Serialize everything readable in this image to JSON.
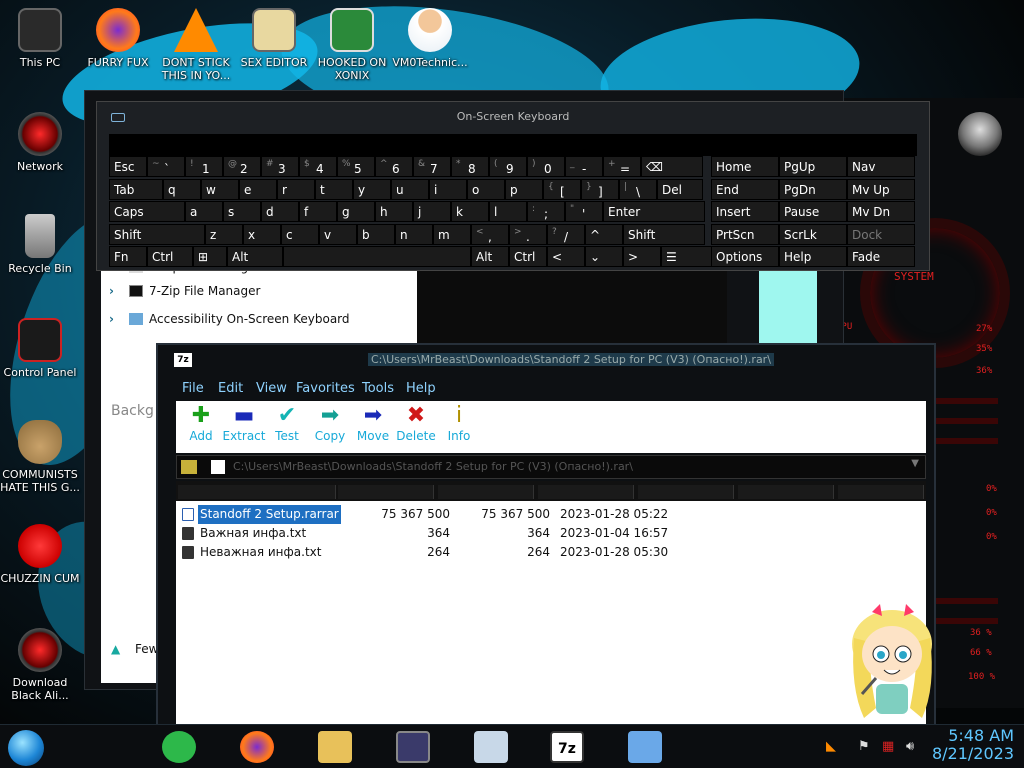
{
  "desktop_icons": [
    {
      "label": "This PC",
      "icon": "pc-icon"
    },
    {
      "label": "FURRY FUX",
      "icon": "firefox-icon"
    },
    {
      "label": "DONT STICK THIS IN YO...",
      "icon": "vlc-icon"
    },
    {
      "label": "SEX EDITOR",
      "icon": "hex-editor-icon"
    },
    {
      "label": "HOOKED ON XONIX",
      "icon": "xonix-icon"
    },
    {
      "label": "VM0Technic...",
      "icon": "doctor-icon"
    },
    {
      "label": "Network",
      "icon": "network-icon"
    },
    {
      "label": "Recycle Bin",
      "icon": "recycle-bin-icon"
    },
    {
      "label": "Control Panel",
      "icon": "control-panel-icon"
    },
    {
      "label": "COMMUNISTS HATE THIS G...",
      "icon": "money-bag-icon"
    },
    {
      "label": "CHUZZIN CUM",
      "icon": "chuzzle-icon"
    },
    {
      "label": "Download Black Ali...",
      "icon": "alien-icon"
    }
  ],
  "background_window": {
    "items": [
      {
        "label": "7-Zip File Manager"
      },
      {
        "label": "7-Zip File Manager"
      },
      {
        "label": "Accessibility On-Screen Keyboard"
      }
    ],
    "section_label": "Backg",
    "footer_label": "Fewe"
  },
  "osk": {
    "title": "On-Screen Keyboard",
    "row1": [
      {
        "main": "Esc"
      },
      {
        "sub": "~",
        "main": "`"
      },
      {
        "sub": "!",
        "main": "1"
      },
      {
        "sub": "@",
        "main": "2"
      },
      {
        "sub": "#",
        "main": "3"
      },
      {
        "sub": "$",
        "main": "4"
      },
      {
        "sub": "%",
        "main": "5"
      },
      {
        "sub": "^",
        "main": "6"
      },
      {
        "sub": "&",
        "main": "7"
      },
      {
        "sub": "*",
        "main": "8"
      },
      {
        "sub": "(",
        "main": "9"
      },
      {
        "sub": ")",
        "main": "0"
      },
      {
        "sub": "_",
        "main": "-"
      },
      {
        "sub": "+",
        "main": "="
      },
      {
        "main": "⌫"
      }
    ],
    "row2": [
      "Tab",
      "q",
      "w",
      "e",
      "r",
      "t",
      "y",
      "u",
      "i",
      "o",
      "p",
      "[",
      "]",
      "\\",
      "Del"
    ],
    "row2_subs": {
      "11": "{",
      "12": "}",
      "13": "|"
    },
    "row3": [
      "Caps",
      "a",
      "s",
      "d",
      "f",
      "g",
      "h",
      "j",
      "k",
      "l",
      ";",
      "'",
      "Enter"
    ],
    "row3_subs": {
      "10": ":",
      "11": "\""
    },
    "row4": [
      "Shift",
      "z",
      "x",
      "c",
      "v",
      "b",
      "n",
      "m",
      ",",
      ".",
      "/",
      "^",
      "Shift"
    ],
    "row4_subs": {
      "8": "<",
      "9": ">",
      "10": "?"
    },
    "row5": [
      "Fn",
      "Ctrl",
      "⊞",
      "Alt",
      "",
      "Alt",
      "Ctrl",
      "<",
      "⌄",
      ">",
      "☰"
    ],
    "nav": [
      [
        "Home",
        "PgUp",
        "Nav"
      ],
      [
        "End",
        "PgDn",
        "Mv Up"
      ],
      [
        "Insert",
        "Pause",
        "Mv Dn"
      ],
      [
        "PrtScn",
        "ScrLk",
        "Dock"
      ],
      [
        "Options",
        "Help",
        "Fade"
      ]
    ]
  },
  "zip": {
    "title": "C:\\Users\\MrBeast\\Downloads\\Standoff 2 Setup for PC (V3) (Опасно!).rar\\",
    "menu": [
      "File",
      "Edit",
      "View",
      "Favorites",
      "Tools",
      "Help"
    ],
    "toolbar": [
      {
        "label": "Add",
        "glyph": "✚",
        "color": "#1aa01a",
        "icon": "add-icon"
      },
      {
        "label": "Extract",
        "glyph": "▬",
        "color": "#1a2ab8",
        "icon": "extract-icon"
      },
      {
        "label": "Test",
        "glyph": "✔",
        "color": "#14b4b4",
        "icon": "test-icon"
      },
      {
        "label": "Copy",
        "glyph": "➡",
        "color": "#14a094",
        "icon": "copy-icon"
      },
      {
        "label": "Move",
        "glyph": "➡",
        "color": "#1a2ab8",
        "icon": "move-icon"
      },
      {
        "label": "Delete",
        "glyph": "✖",
        "color": "#d01818",
        "icon": "delete-icon"
      },
      {
        "label": "Info",
        "glyph": "i",
        "color": "#b09000",
        "icon": "info-icon"
      }
    ],
    "address": "C:\\Users\\MrBeast\\Downloads\\Standoff 2 Setup for PC (V3) (Опасно!).rar\\",
    "files": [
      {
        "name": "Standoff 2 Setup.rarrar",
        "size": "75 367 500",
        "packed": "75 367 500",
        "modified": "2023-01-28 05:22",
        "selected": true
      },
      {
        "name": "Важная инфа.txt",
        "size": "364",
        "packed": "364",
        "modified": "2023-01-04 16:57",
        "selected": false
      },
      {
        "name": "Неважная инфа.txt",
        "size": "264",
        "packed": "264",
        "modified": "2023-01-28 05:30",
        "selected": false
      }
    ]
  },
  "sidepanel": {
    "labels": [
      "SYSTEM",
      "CPU",
      "27%",
      "35%",
      "36%",
      "0%",
      "0%",
      "0%",
      "36 %",
      "66 %",
      "100 %"
    ]
  },
  "taskbar": {
    "apps": [
      "green-app-icon",
      "firefox-icon",
      "explorer-icon",
      "media-icon",
      "monitor-icon",
      "7zip-icon",
      "computer-icon"
    ],
    "active_label": "7z",
    "time": "5:48 AM",
    "date": "8/21/2023"
  },
  "colors": {
    "accent": "#12b6e8",
    "link": "#17a9d8",
    "selection": "#1e6fc2",
    "panel_red": "#e02020"
  }
}
